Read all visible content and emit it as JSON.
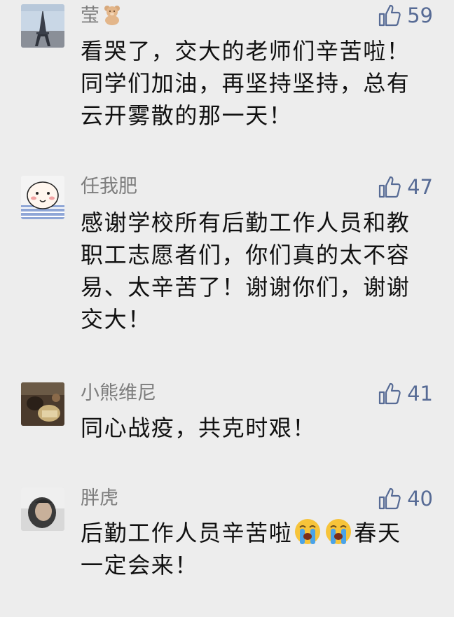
{
  "comments": [
    {
      "username": "莹",
      "user_emoji": "teddy-bear",
      "likes": "59",
      "lines": [
        "看哭了，交大的老师们辛苦啦！",
        "同学们加油，再坚持坚持，总有",
        "云开雾散的那一天！"
      ]
    },
    {
      "username": "任我肥",
      "likes": "47",
      "lines": [
        "感谢学校所有后勤工作人员和教",
        "职工志愿者们，你们真的太不容",
        "易、太辛苦了！谢谢你们，谢谢",
        "交大！"
      ]
    },
    {
      "username": "小熊维尼",
      "likes": "41",
      "lines": [
        "同心战疫，共克时艰！"
      ]
    },
    {
      "username": "胖虎",
      "likes": "40",
      "line1_part1": "后勤工作人员辛苦啦",
      "line1_part2": "春天",
      "line2": "一定会来！",
      "emoji": "loudly-crying-face"
    }
  ],
  "colors": {
    "background": "#ededed",
    "username": "#7d7d7d",
    "like_accent": "#576b95",
    "text": "#111111"
  },
  "icons": [
    "thumbs-up-icon",
    "teddy-bear-icon",
    "loudly-crying-face-icon"
  ]
}
